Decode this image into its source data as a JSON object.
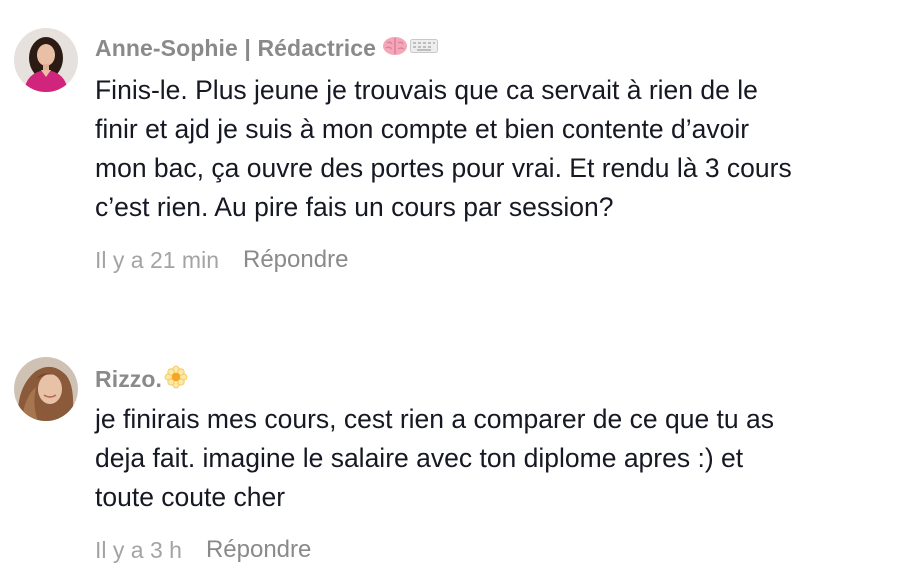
{
  "comments": [
    {
      "author": "Anne-Sophie | Rédactrice",
      "author_emojis": [
        "brain-icon",
        "keyboard-icon"
      ],
      "lines": [
        "Finis-le. Plus jeune je trouvais que ca servait à rien de le",
        "finir et ajd je suis à mon compte et bien contente d’avoir",
        "mon bac, ça ouvre des portes pour vrai. Et rendu là 3 cours",
        "c’est rien. Au pire fais un cours par session?"
      ],
      "time": "Il y a 21 min",
      "reply_label": "Répondre"
    },
    {
      "author": "Rizzo.",
      "author_emojis": [
        "flower-icon"
      ],
      "lines": [
        "je finirais mes cours, cest rien a comparer de ce que tu as",
        "deja fait. imagine le salaire avec ton diplome apres :) et",
        "toute coute cher"
      ],
      "time": "Il y a 3 h",
      "reply_label": "Répondre"
    }
  ],
  "colors": {
    "author": "#8a8a8a",
    "body": "#161823",
    "time": "#a3a3a3",
    "reply": "#8a8a8a"
  }
}
